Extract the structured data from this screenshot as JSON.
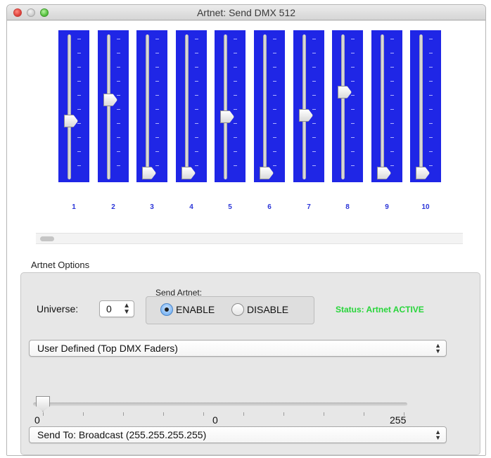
{
  "window": {
    "title": "Artnet: Send DMX 512"
  },
  "faders": [
    {
      "label": "1",
      "level": 0.4
    },
    {
      "label": "2",
      "level": 0.56
    },
    {
      "label": "3",
      "level": 0.0
    },
    {
      "label": "4",
      "level": 0.0
    },
    {
      "label": "5",
      "level": 0.43
    },
    {
      "label": "6",
      "level": 0.0
    },
    {
      "label": "7",
      "level": 0.44
    },
    {
      "label": "8",
      "level": 0.62
    },
    {
      "label": "9",
      "level": 0.0
    },
    {
      "label": "10",
      "level": 0.0
    }
  ],
  "fader_color": "#1f26e6",
  "options": {
    "group_label": "Artnet Options",
    "universe_label": "Universe:",
    "universe_value": "0",
    "send_artnet_label": "Send Artnet:",
    "enable_label": "ENABLE",
    "disable_label": "DISABLE",
    "send_selected": "enable",
    "status_text": "Status: Artnet ACTIVE",
    "status_color": "#27d53a",
    "source_popup": "User Defined (Top DMX Faders)",
    "slider_min": "0",
    "slider_value": "0",
    "slider_max": "255",
    "send_to_popup": "Send To: Broadcast (255.255.255.255)"
  }
}
